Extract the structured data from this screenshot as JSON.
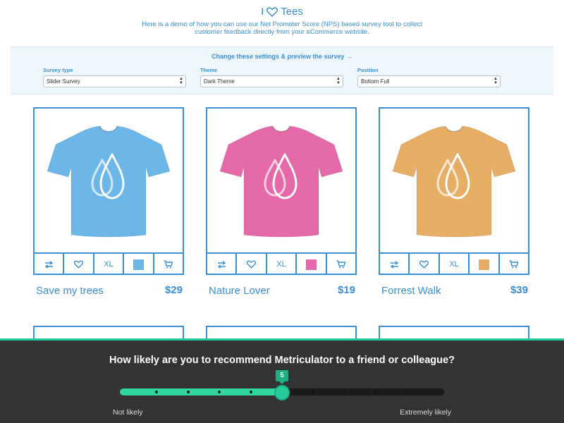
{
  "header": {
    "brand_prefix": "I",
    "brand_suffix": "Tees",
    "tagline": "Here is a demo of how you can use our Net Promoter Score (NPS) based survey tool to collect customer feedback directly from your eCommerce website."
  },
  "settings": {
    "title": "Change these settings & preview the survey →",
    "fields": [
      {
        "label": "Survey type",
        "value": "Slider Survey"
      },
      {
        "label": "Theme",
        "value": "Dark Theme"
      },
      {
        "label": "Position",
        "value": "Bottom Full"
      }
    ]
  },
  "products": [
    {
      "name": "Save my trees",
      "price": "$29",
      "size": "XL",
      "color": "#6cb6e8"
    },
    {
      "name": "Nature Lover",
      "price": "$19",
      "size": "XL",
      "color": "#e568a8"
    },
    {
      "name": "Forrest Walk",
      "price": "$39",
      "size": "XL",
      "color": "#e6ad64"
    }
  ],
  "survey": {
    "question": "How likely are you to recommend Metriculator to a friend or colleague?",
    "value": 5,
    "value_label": "5",
    "min": 0,
    "max": 10,
    "low_label": "Not likely",
    "high_label": "Extremely likely",
    "accent": "#25c99a"
  },
  "icons": {
    "brand": "heart-outline-icon",
    "compare": "compare-arrows-icon",
    "favorite": "heart-icon",
    "cart": "cart-icon",
    "logo": "water-drop-logo"
  }
}
